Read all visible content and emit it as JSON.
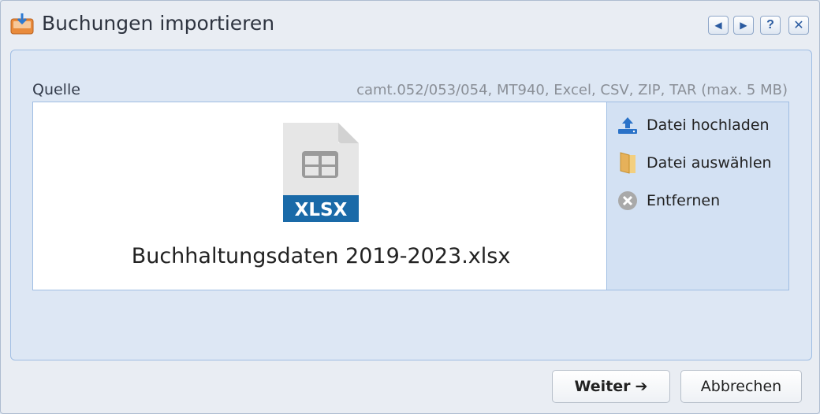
{
  "window": {
    "title": "Buchungen importieren",
    "buttons": {
      "prev": "◀",
      "next": "▶",
      "help": "?",
      "close": "✕"
    }
  },
  "source": {
    "label": "Quelle",
    "formats": "camt.052/053/054, MT940, Excel, CSV, ZIP, TAR (max. 5 MB)",
    "file": {
      "name": "Buchhaltungsdaten 2019-2023.xlsx",
      "type_badge": "XLSX"
    }
  },
  "actions": [
    {
      "label": "Datei hochladen",
      "icon": "upload-icon"
    },
    {
      "label": "Datei auswählen",
      "icon": "folder-icon"
    },
    {
      "label": "Entfernen",
      "icon": "remove-icon"
    }
  ],
  "footer": {
    "next_label": "Weiter",
    "next_arrow": "➔",
    "cancel_label": "Abbrechen"
  },
  "colors": {
    "accent": "#1e6fbf",
    "panel": "#dde7f4",
    "badge": "#1a6aa8"
  }
}
